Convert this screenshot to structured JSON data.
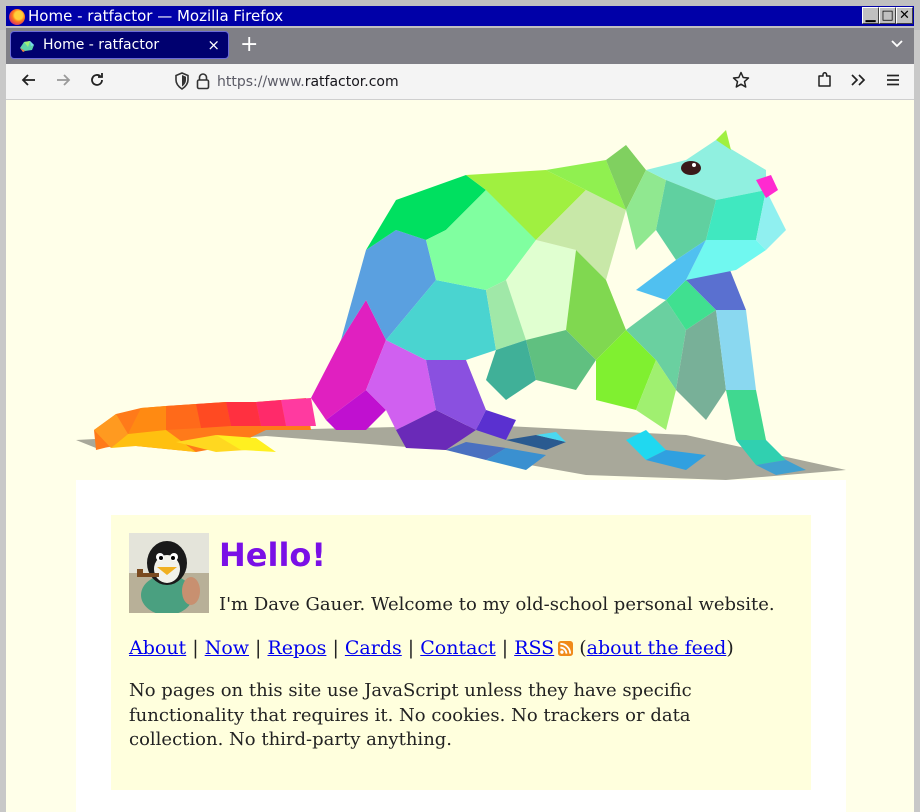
{
  "window": {
    "title": "Home - ratfactor — Mozilla Firefox",
    "minimize": "▁",
    "maximize": "□",
    "close": "✕"
  },
  "tabs": [
    {
      "label": "Home - ratfactor",
      "close": "×"
    }
  ],
  "tabbar": {
    "new_tab": "+",
    "list_all": "⌄"
  },
  "navbar": {
    "back": "←",
    "forward": "→",
    "reload": "↻",
    "url_prefix": "https://www.",
    "url_domain": "ratfactor.com",
    "bookmark": "☆",
    "extensions": "⧉",
    "overflow": "»",
    "menu": "≡"
  },
  "page": {
    "heading": "Hello!",
    "intro": "I'm Dave Gauer. Welcome to my old-school personal website.",
    "links": [
      "About",
      "Now",
      "Repos",
      "Cards",
      "Contact",
      "RSS"
    ],
    "feed_link": "about the feed",
    "paragraph": "No pages on this site use JavaScript unless they have specific functionality that requires it. No cookies. No trackers or data collection. No third-party anything."
  },
  "icons": {
    "browser": "firefox-icon",
    "favicon": "rat-favicon",
    "security": "shield-icon",
    "lock": "lock-icon",
    "feed": "rss-icon"
  },
  "colors": {
    "titlebar": "#0000a8",
    "tab_active": "#00006f",
    "page_background": "#ffffe9",
    "card_background": "#ffffdd",
    "heading": "#7a10e6",
    "link": "#0000ee"
  }
}
